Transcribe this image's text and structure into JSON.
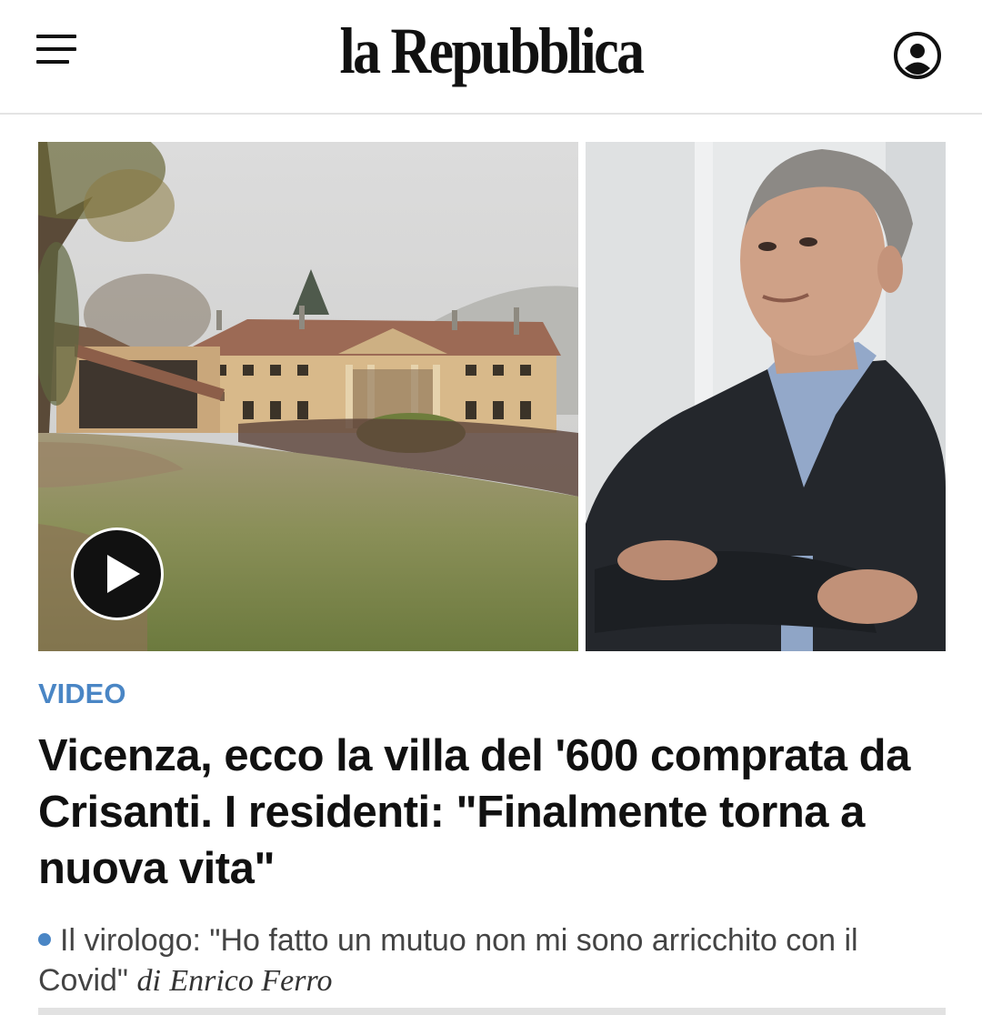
{
  "header": {
    "logo_text": "la Repubblica",
    "menu_icon": "hamburger-menu-icon",
    "account_icon": "user-account-icon"
  },
  "article": {
    "kicker": "VIDEO",
    "kicker_color": "#4a86c5",
    "headline": "Vicenza, ecco la villa del '600 comprata da Crisanti. I residenti: \"Finalmente torna a nuova vita\"",
    "related": {
      "text": "Il virologo: \"Ho fatto un mutuo non mi sono arricchito con il Covid\"",
      "by": "di",
      "author": "Enrico Ferro"
    },
    "media": {
      "left_image": "villa-photo",
      "right_image": "portrait-photo",
      "play_icon": "play-icon"
    }
  }
}
